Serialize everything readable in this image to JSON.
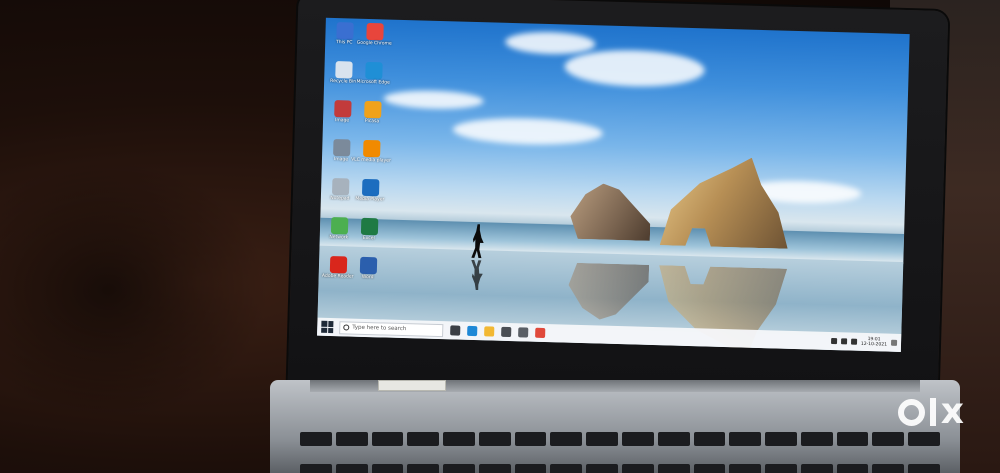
{
  "desktop": {
    "icons": [
      {
        "label": "This PC",
        "color": "#3a6fd1"
      },
      {
        "label": "Google Chrome",
        "color": "#e8453c"
      },
      {
        "label": "Recycle Bin",
        "color": "#d9e3ee"
      },
      {
        "label": "Microsoft Edge",
        "color": "#1f8fd6"
      },
      {
        "label": "Image",
        "color": "#c23b3b"
      },
      {
        "label": "Picasa",
        "color": "#f0a21b"
      },
      {
        "label": "Image",
        "color": "#7b8a9b"
      },
      {
        "label": "VLC media player",
        "color": "#f18a00"
      },
      {
        "label": "Notepad",
        "color": "#a7b2bd"
      },
      {
        "label": "Media Player",
        "color": "#1c6dbf"
      },
      {
        "label": "Network",
        "color": "#4caf50"
      },
      {
        "label": "Excel",
        "color": "#1f7a44"
      },
      {
        "label": "Adobe Reader",
        "color": "#d9261c"
      },
      {
        "label": "Word",
        "color": "#2b5fad"
      }
    ]
  },
  "taskbar": {
    "search_placeholder": "Type here to search",
    "apps": [
      {
        "name": "task-view",
        "color": "#3b3f45"
      },
      {
        "name": "edge",
        "color": "#1e88d6"
      },
      {
        "name": "explorer",
        "color": "#f2b833"
      },
      {
        "name": "store",
        "color": "#4b4f55"
      },
      {
        "name": "mail",
        "color": "#5a5f66"
      },
      {
        "name": "chrome",
        "color": "#e0493b"
      }
    ],
    "clock_time": "19:01",
    "clock_date": "12-10-2021"
  },
  "sticker_text": "",
  "watermark": "OLX",
  "colors": {
    "taskbar": "#f5f7fa",
    "sky": "#3f8fdc"
  }
}
